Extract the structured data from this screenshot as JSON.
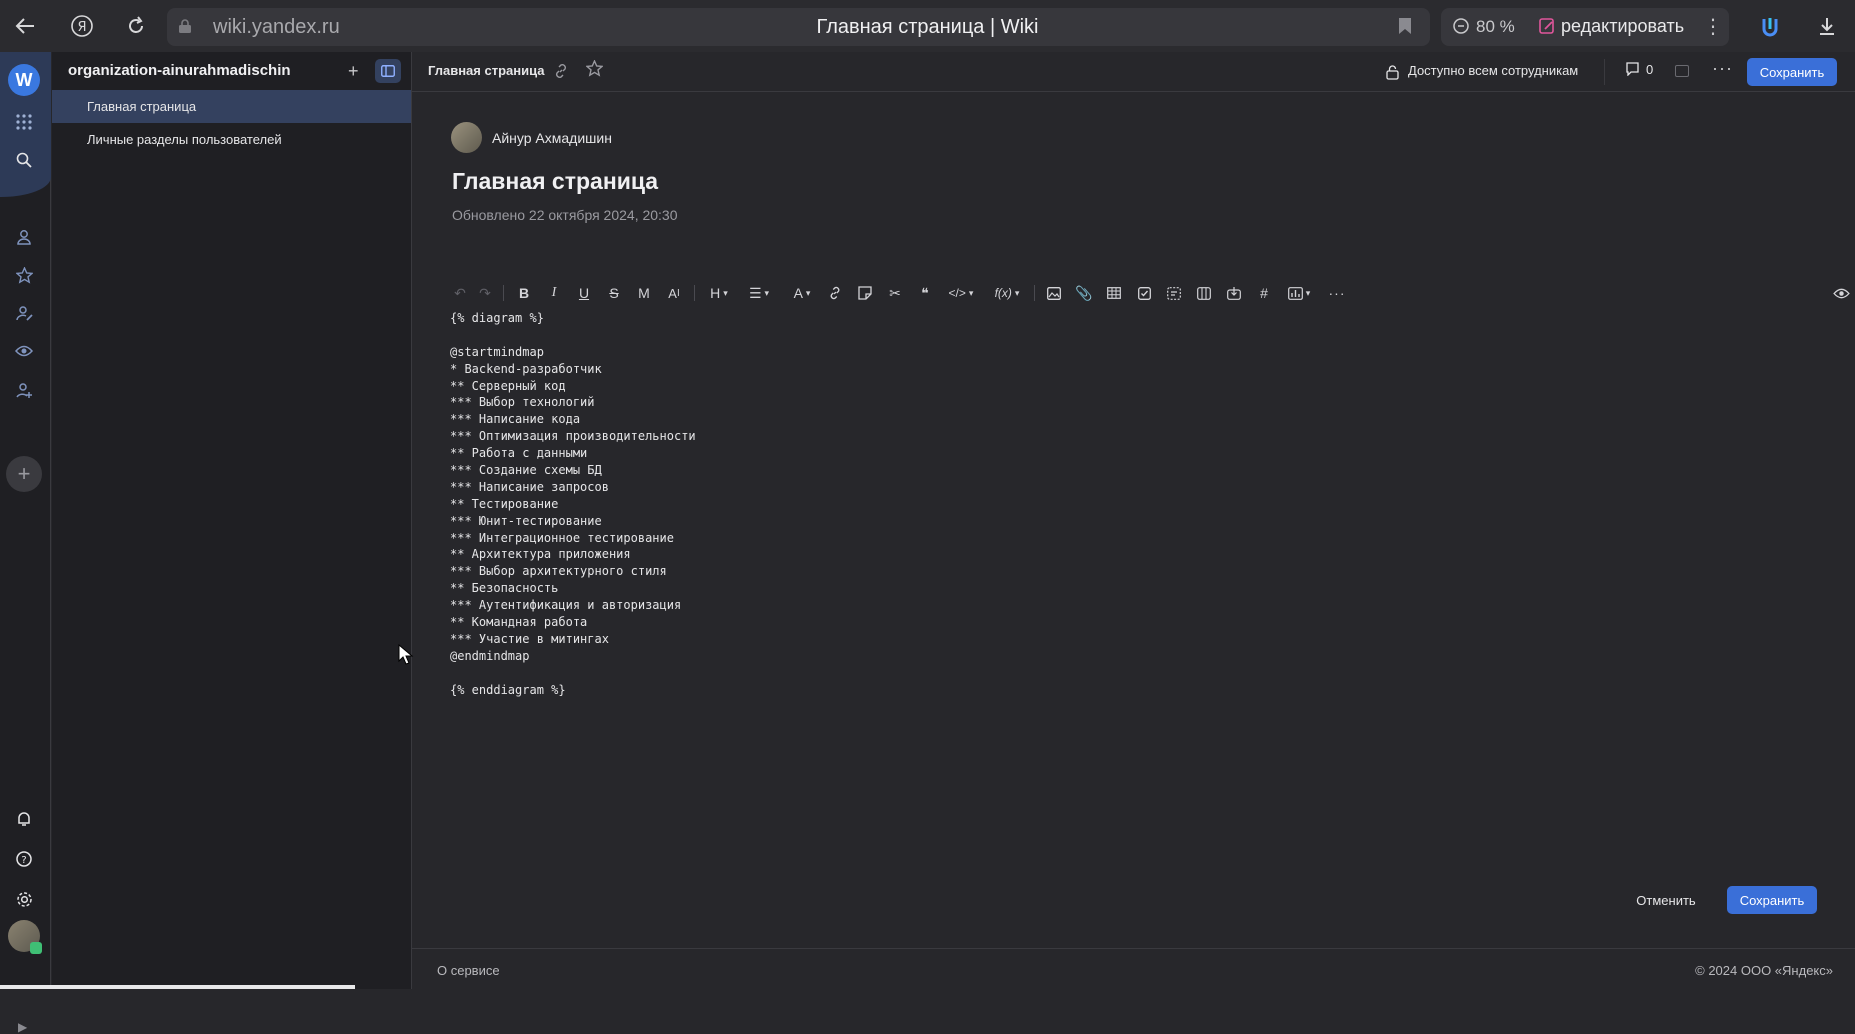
{
  "browser": {
    "url": "wiki.yandex.ru",
    "title": "Главная страница | Wiki",
    "zoom": "80 %",
    "edit_label": "редактировать"
  },
  "rail": {
    "logo_letter": "W"
  },
  "sidebar": {
    "org_name": "organization-ainurahmadischin",
    "items": [
      {
        "label": "Главная страница",
        "active": true
      },
      {
        "label": "Личные разделы пользователей",
        "active": false
      }
    ]
  },
  "topbar": {
    "breadcrumb": "Главная страница",
    "access": "Доступно всем сотрудникам",
    "comments_count": "0",
    "save_label": "Сохранить"
  },
  "doc": {
    "author": "Айнур Ахмадишин",
    "title": "Главная страница",
    "updated": "Обновлено 22 октября 2024, 20:30"
  },
  "editor": {
    "lines": [
      "{% diagram %}",
      "",
      "@startmindmap",
      "* Backend-разработчик",
      "** Серверный код",
      "*** Выбор технологий",
      "*** Написание кода",
      "*** Оптимизация производительности",
      "** Работа с данными",
      "*** Создание схемы БД",
      "*** Написание запросов",
      "** Тестирование",
      "*** Юнит-тестирование",
      "*** Интеграционное тестирование",
      "** Архитектура приложения",
      "*** Выбор архитектурного стиля",
      "** Безопасность",
      "*** Аутентификация и авторизация",
      "** Командная работа",
      "*** Участие в митингах",
      "@endmindmap",
      "",
      "{% enddiagram %}"
    ]
  },
  "actions": {
    "cancel_label": "Отменить",
    "save_label": "Сохранить"
  },
  "footer": {
    "about": "О сервисе",
    "copyright": "© 2024 ООО «Яндекс»"
  },
  "colors": {
    "accent": "#3a6fd8",
    "active_item": "#34415f",
    "background": "#27272b"
  }
}
